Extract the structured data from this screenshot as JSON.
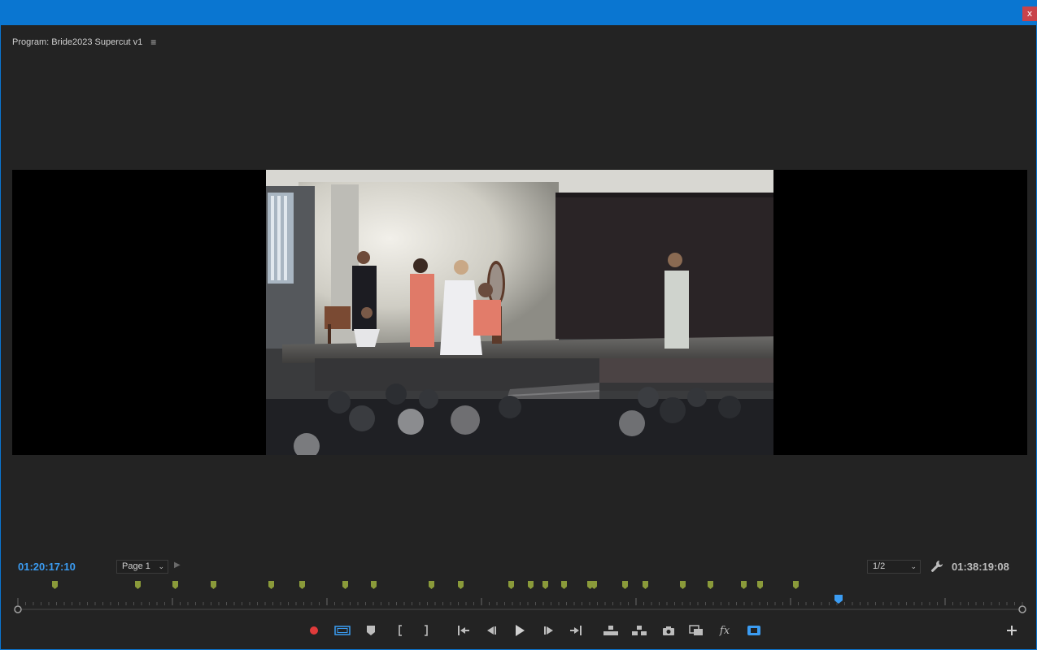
{
  "window": {
    "close_label": "x"
  },
  "panel": {
    "title": "Program: Bride2023 Supercut v1",
    "menu_icon": "hamburger-menu-icon"
  },
  "timecode": {
    "current": "01:20:17:10",
    "duration": "01:38:19:08"
  },
  "page_select": {
    "value": "Page 1"
  },
  "zoom_select": {
    "value": "1/2"
  },
  "colors": {
    "accent": "#3b9cf2",
    "titlebar": "#0a76d1",
    "marker": "#8a9a3a",
    "record": "#e03b3b"
  },
  "playhead_fraction": 0.817,
  "transport": [
    {
      "name": "record-button",
      "icon": "record-icon"
    },
    {
      "name": "safe-margins-button",
      "icon": "safe-margins-icon"
    },
    {
      "name": "add-marker-button",
      "icon": "marker-icon"
    },
    {
      "name": "mark-in-button",
      "icon": "mark-in-icon"
    },
    {
      "name": "mark-out-button",
      "icon": "mark-out-icon"
    },
    {
      "name": "go-to-in-button",
      "icon": "go-to-in-icon"
    },
    {
      "name": "step-back-button",
      "icon": "step-back-icon"
    },
    {
      "name": "play-button",
      "icon": "play-icon"
    },
    {
      "name": "step-forward-button",
      "icon": "step-forward-icon"
    },
    {
      "name": "go-to-out-button",
      "icon": "go-to-out-icon"
    },
    {
      "name": "lift-button",
      "icon": "lift-icon"
    },
    {
      "name": "extract-button",
      "icon": "extract-icon"
    },
    {
      "name": "export-frame-button",
      "icon": "camera-icon"
    },
    {
      "name": "comparison-view-button",
      "icon": "comparison-view-icon"
    },
    {
      "name": "global-fx-mute-button",
      "icon": "fx-icon"
    },
    {
      "name": "vr-toggle-button",
      "icon": "vr-toggle-icon"
    },
    {
      "name": "add-button",
      "icon": "plus-icon"
    }
  ]
}
